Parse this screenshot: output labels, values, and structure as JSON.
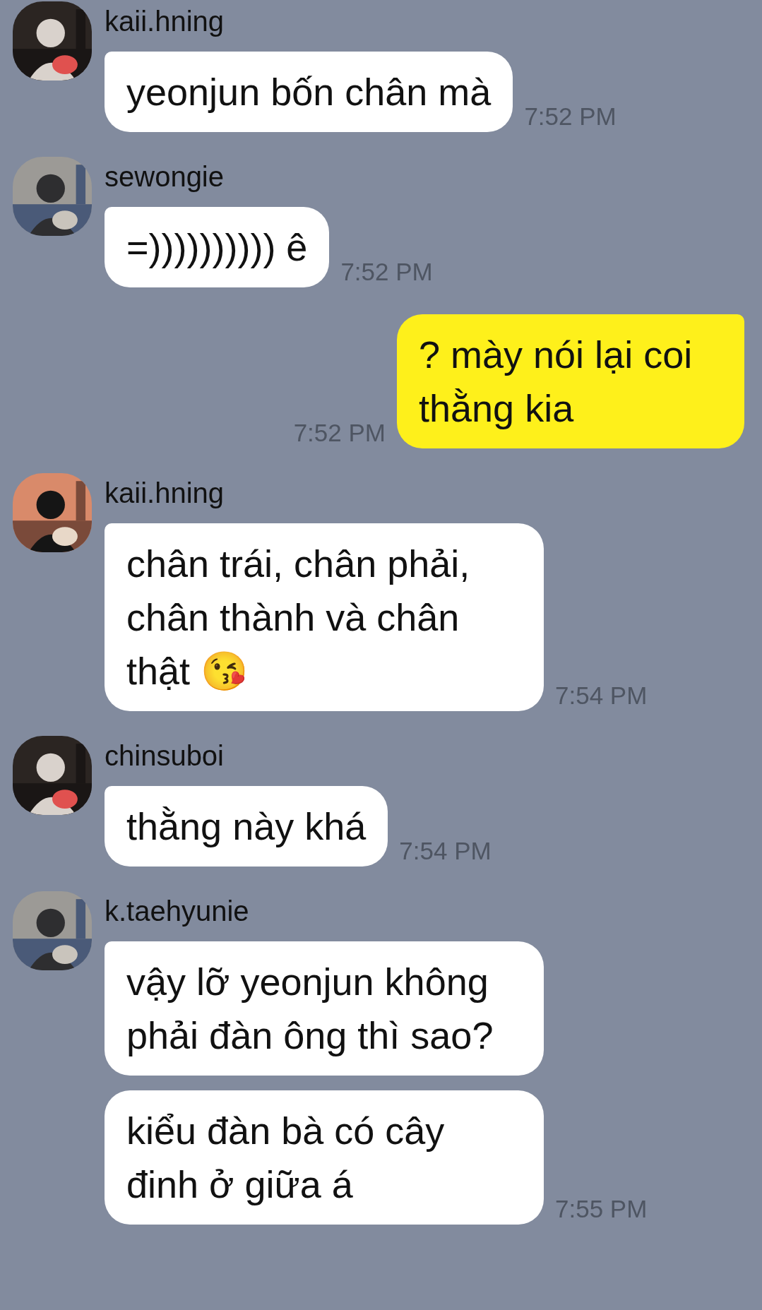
{
  "messages": [
    {
      "kind": "incoming",
      "sender": "kaii.hning",
      "avatar": {
        "kind": "picture"
      },
      "bubbles": [
        {
          "text": "yeonjun bốn chân mà",
          "time": "7:52 PM"
        }
      ]
    },
    {
      "kind": "incoming",
      "sender": "sewongie",
      "avatar": {
        "kind": "picture"
      },
      "bubbles": [
        {
          "text": "=)))))))))) ê",
          "time": "7:52 PM"
        }
      ]
    },
    {
      "kind": "outgoing",
      "bubbles": [
        {
          "text": "? mày nói lại coi thằng kia",
          "time": "7:52 PM"
        }
      ]
    },
    {
      "kind": "incoming",
      "sender": "kaii.hning",
      "avatar": {
        "kind": "picture"
      },
      "bubbles": [
        {
          "text": "chân trái, chân phải, chân thành và chân thật 😘",
          "time": "7:54 PM"
        }
      ]
    },
    {
      "kind": "incoming",
      "sender": "chinsuboi",
      "avatar": {
        "kind": "picture"
      },
      "bubbles": [
        {
          "text": "thằng này khá",
          "time": "7:54 PM"
        }
      ]
    },
    {
      "kind": "incoming",
      "sender": "k.taehyunie",
      "avatar": {
        "kind": "picture"
      },
      "bubbles": [
        {
          "text": "vậy lỡ yeonjun không phải đàn ông thì sao?"
        },
        {
          "text": "kiểu đàn bà có cây đinh ở giữa á",
          "time": "7:55 PM"
        }
      ]
    }
  ]
}
